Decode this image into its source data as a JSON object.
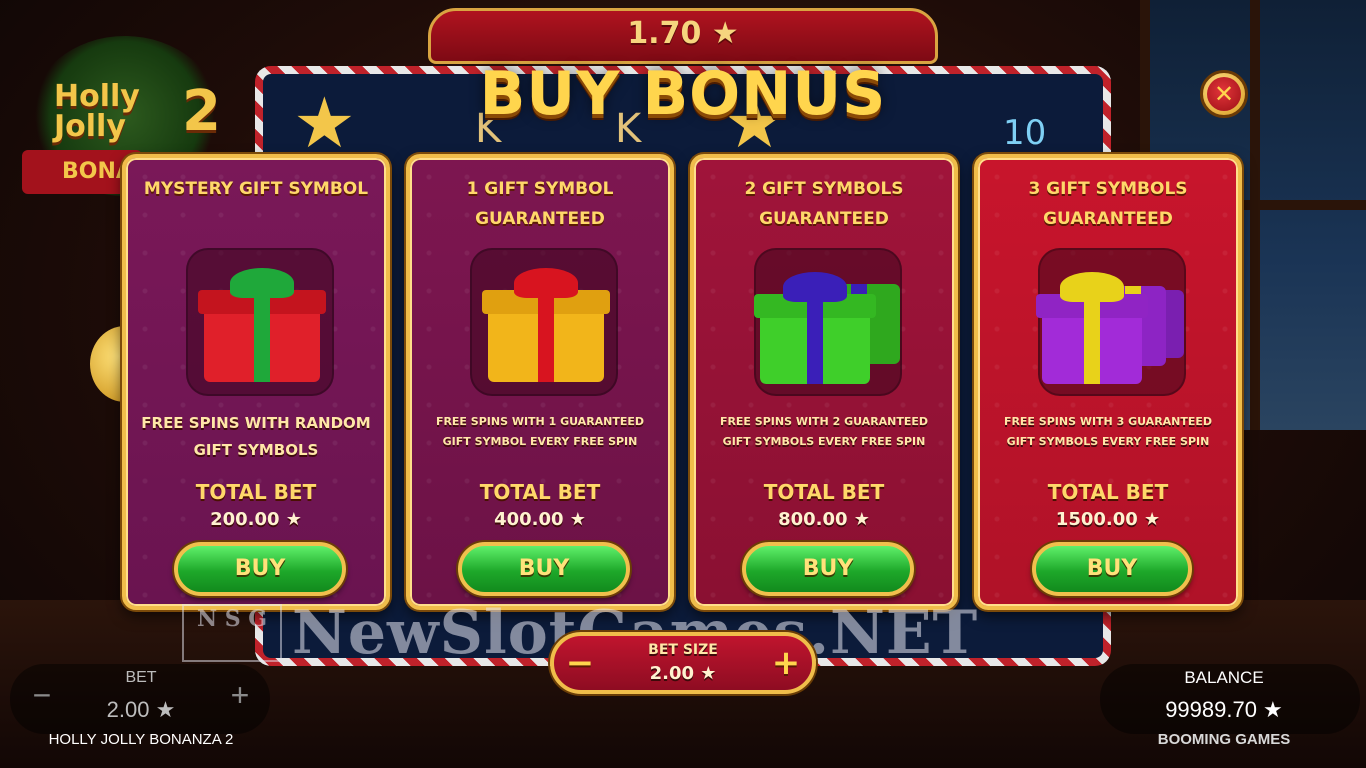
{
  "header": {
    "price": "1.70 ★",
    "title": "BUY BONUS"
  },
  "background": {
    "logo_line1": "Holly",
    "logo_line2": "Jolly",
    "logo_number": "2",
    "logo_banner": "BONA"
  },
  "cards": [
    {
      "title": "MYSTERY GIFT SYMBOL",
      "description": "FREE SPINS WITH RANDOM GIFT SYMBOLS",
      "total_label": "TOTAL BET",
      "total_value": "200.00 ★",
      "buy_label": "BUY",
      "gift_color": "#e0202a",
      "ribbon_color": "#1fa83a"
    },
    {
      "title": "1 GIFT SYMBOL GUARANTEED",
      "description": "FREE SPINS WITH 1 GUARANTEED GIFT SYMBOL EVERY FREE SPIN",
      "total_label": "TOTAL BET",
      "total_value": "400.00 ★",
      "buy_label": "BUY",
      "gift_color": "#f2b51a",
      "ribbon_color": "#d8141f"
    },
    {
      "title": "2 GIFT SYMBOLS GUARANTEED",
      "description": "FREE SPINS WITH 2 GUARANTEED GIFT SYMBOLS EVERY FREE SPIN",
      "total_label": "TOTAL BET",
      "total_value": "800.00 ★",
      "buy_label": "BUY",
      "gift_color": "#3fcf2a",
      "ribbon_color": "#3a1fb8"
    },
    {
      "title": "3 GIFT SYMBOLS GUARANTEED",
      "description": "FREE SPINS WITH 3 GUARANTEED GIFT SYMBOLS EVERY FREE SPIN",
      "total_label": "TOTAL BET",
      "total_value": "1500.00 ★",
      "buy_label": "BUY",
      "gift_color": "#a22bd8",
      "ribbon_color": "#e8d21a"
    }
  ],
  "bet_size": {
    "label": "BET SIZE",
    "value": "2.00 ★",
    "minus": "−",
    "plus": "+"
  },
  "bet_widget": {
    "label": "BET",
    "value": "2.00 ★",
    "minus": "−",
    "plus": "+"
  },
  "game_name": "HOLLY JOLLY BONANZA 2",
  "balance": {
    "label": "BALANCE",
    "value": "99989.70 ★"
  },
  "brand": "BOOMING GAMES",
  "close_symbol": "✕",
  "watermark": {
    "logo": "N S G",
    "text": "NewSlotGames.NET"
  },
  "board_symbols": [
    "★",
    "K",
    "K",
    "★",
    "10"
  ]
}
